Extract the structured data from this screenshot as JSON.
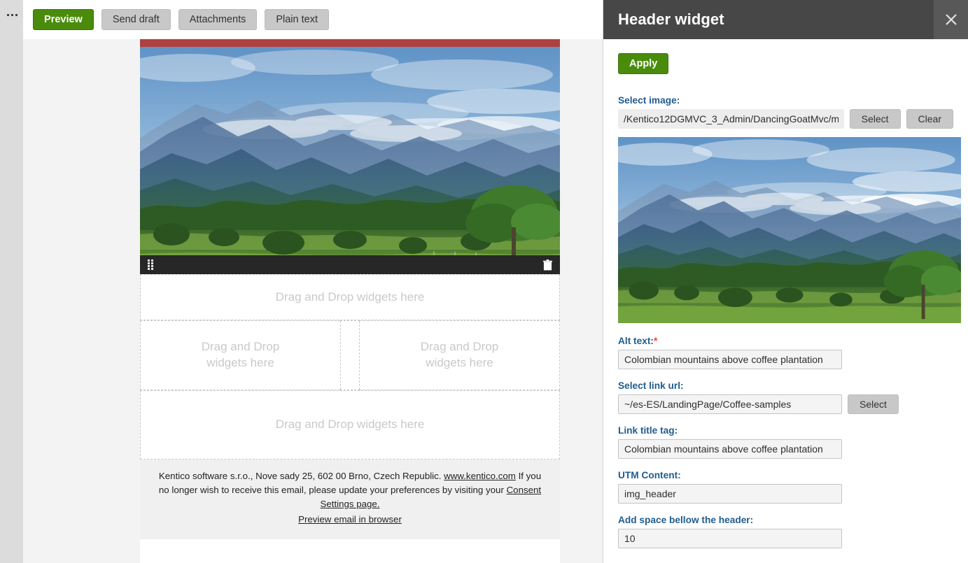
{
  "left_rail": {
    "menu_icon": "ellipsis-icon"
  },
  "toolbar": {
    "preview_label": "Preview",
    "send_draft_label": "Send draft",
    "attachments_label": "Attachments",
    "plain_text_label": "Plain text",
    "accent_green": "#4a8b0c",
    "button_gray": "#c8c8c8"
  },
  "email": {
    "top_bar_color": "#b04040",
    "hero": {
      "alt": "Colombian mountains above coffee plantation",
      "widget_drag_icon": "drag-handle-icon",
      "widget_delete_icon": "trash-icon"
    },
    "dropzones": {
      "top": "Drag and Drop widgets here",
      "left": "Drag and Drop\nwidgets here",
      "left_line1": "Drag and Drop",
      "left_line2": "widgets here",
      "right_line1": "Drag and Drop",
      "right_line2": "widgets here",
      "bottom": "Drag and Drop widgets here"
    },
    "footer": {
      "line1_prefix": "Kentico software s.r.o., Nove sady 25, 602 00 Brno, Czech Republic. ",
      "kentico_link": "www.kentico.com",
      "line1_suffix": "  If you no longer wish to receive this email, please update your preferences by visiting your ",
      "consent_link": "Consent Settings page.",
      "preview_link": "Preview email in browser"
    }
  },
  "panel": {
    "title": "Header widget",
    "close_icon": "close-icon",
    "header_bg": "#474747",
    "apply_label": "Apply",
    "fields": {
      "select_image": {
        "label": "Select image:",
        "value": "/Kentico12DGMVC_3_Admin/DancingGoatMvc/m",
        "select_label": "Select",
        "clear_label": "Clear"
      },
      "alt_text": {
        "label": "Alt text:",
        "required_marker": "*",
        "value": "Colombian mountains above coffee plantation"
      },
      "link_url": {
        "label": "Select link url:",
        "value": "~/es-ES/LandingPage/Coffee-samples",
        "select_label": "Select"
      },
      "link_title": {
        "label": "Link title tag:",
        "value": "Colombian mountains above coffee plantation"
      },
      "utm_content": {
        "label": "UTM Content:",
        "value": "img_header"
      },
      "space_below": {
        "label": "Add space bellow the header:",
        "value": "10"
      }
    },
    "preview_image_alt": "Colombian mountains above coffee plantation"
  }
}
